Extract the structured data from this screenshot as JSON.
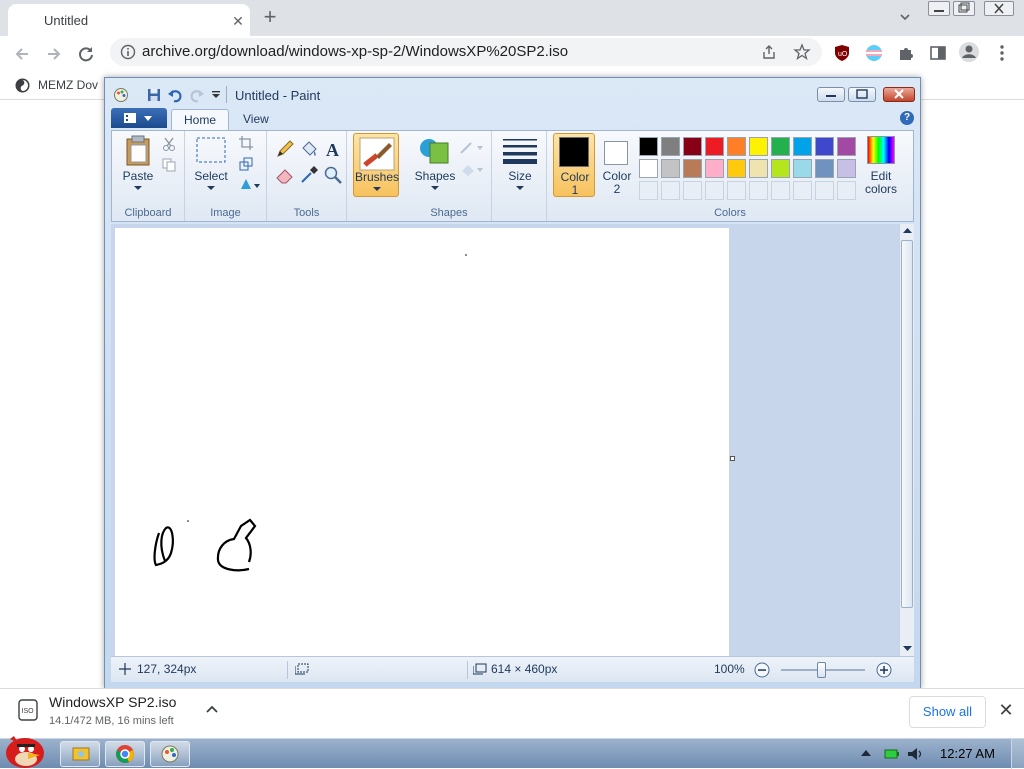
{
  "browser": {
    "tab_title": "Untitled",
    "url": "archive.org/download/windows-xp-sp-2/WindowsXP%20SP2.iso",
    "bookmark_label": "MEMZ Dov",
    "icons": [
      "new-tab-icon",
      "back-icon",
      "forward-icon",
      "reload-icon",
      "site-info-icon",
      "share-icon",
      "bookmark-star-icon",
      "extensions-icon",
      "sidebar-icon",
      "profile-icon",
      "menu-icon"
    ]
  },
  "paint": {
    "title": "Untitled - Paint",
    "tabs": [
      "Home",
      "View"
    ],
    "groups": {
      "clipboard": {
        "label": "Clipboard",
        "paste": "Paste"
      },
      "image": {
        "label": "Image",
        "select": "Select"
      },
      "tools": {
        "label": "Tools"
      },
      "brushes": {
        "label": "Brushes"
      },
      "shapes": {
        "label": "Shapes",
        "shapes": "Shapes"
      },
      "size": {
        "label": "Size"
      },
      "colors": {
        "label": "Colors",
        "color1": "Color",
        "color1_num": "1",
        "color2": "Color",
        "color2_num": "2",
        "edit1": "Edit",
        "edit2": "colors"
      }
    },
    "color1_value": "#000000",
    "color2_value": "#ffffff",
    "palette_row1": [
      "#000000",
      "#7f7f7f",
      "#880015",
      "#ed1c24",
      "#ff7f27",
      "#fff200",
      "#22b14c",
      "#00a2e8",
      "#3f48cc",
      "#a349a4"
    ],
    "palette_row2": [
      "#ffffff",
      "#c3c3c3",
      "#b97a57",
      "#ffaec9",
      "#ffc90e",
      "#efe4b0",
      "#b5e61d",
      "#99d9ea",
      "#7092be",
      "#c8bfe7"
    ],
    "status": {
      "cursor_pos": "127, 324px",
      "canvas_size": "614 × 460px",
      "zoom": "100%"
    }
  },
  "download": {
    "name": "WindowsXP SP2.iso",
    "detail": "14.1/472 MB, 16 mins left",
    "show_all": "Show all"
  },
  "taskbar": {
    "clock": "12:27 AM"
  }
}
